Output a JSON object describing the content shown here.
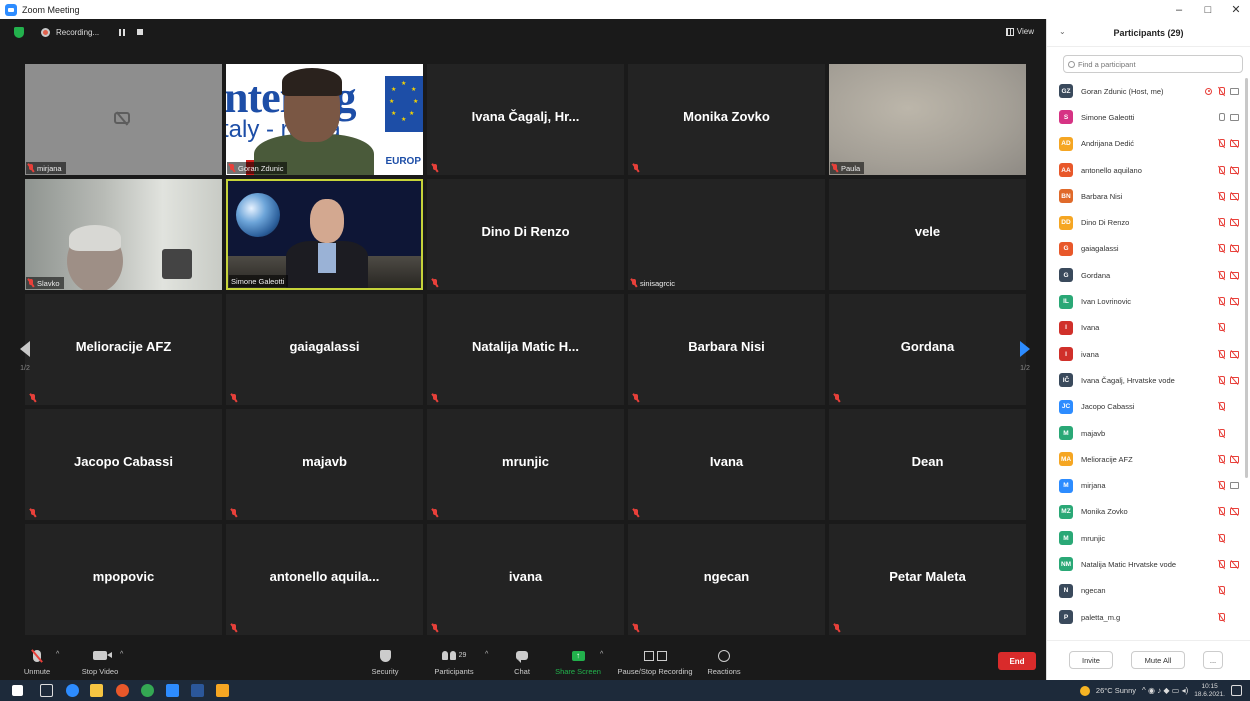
{
  "window": {
    "title": "Zoom Meeting",
    "min": "–",
    "restore": "□",
    "close": "✕"
  },
  "topbar": {
    "recording_label": "Recording...",
    "view_label": "View"
  },
  "tiles": [
    {
      "name": "mirjana"
    },
    {
      "name": "Goran Zdunic"
    },
    {
      "name": "Ivana Čagalj, Hr..."
    },
    {
      "name": "Monika Zovko"
    },
    {
      "name": "Paula"
    },
    {
      "name": "Slavko"
    },
    {
      "name": "Simone Galeotti"
    },
    {
      "name": "Dino Di Renzo"
    },
    {
      "name": "sinisagrcic"
    },
    {
      "name": "vele"
    },
    {
      "name": "Melioracije AFZ"
    },
    {
      "name": "gaiagalassi"
    },
    {
      "name": "Natalija Matic H..."
    },
    {
      "name": "Barbara Nisi"
    },
    {
      "name": "Gordana"
    },
    {
      "name": "Jacopo Cabassi"
    },
    {
      "name": "majavb"
    },
    {
      "name": "mrunjic"
    },
    {
      "name": "Ivana"
    },
    {
      "name": "Dean"
    },
    {
      "name": "mpopovic"
    },
    {
      "name": "antonello aquila..."
    },
    {
      "name": "ivana"
    },
    {
      "name": "ngecan"
    },
    {
      "name": "Petar Maleta"
    }
  ],
  "slide": {
    "brand": "nterreg",
    "line2": "taly - roatia",
    "eu": "EUROP"
  },
  "pager": {
    "left_page": "1/2",
    "right_page": "1/2"
  },
  "toolbar": {
    "unmute": "Unmute",
    "stop_video": "Stop Video",
    "security": "Security",
    "participants": "Participants",
    "participants_count": "29",
    "chat": "Chat",
    "share_screen": "Share Screen",
    "pause_stop_recording": "Pause/Stop Recording",
    "reactions": "Reactions",
    "end": "End"
  },
  "panel": {
    "title": "Participants (29)",
    "search_placeholder": "Find a participant",
    "invite": "Invite",
    "mute_all": "Mute All",
    "more": "...",
    "participants": [
      {
        "initials": "GZ",
        "name": "Goran Zdunic (Host, me)",
        "color": "#3a4a5c",
        "mic": "muted",
        "cam": "on",
        "rec": true
      },
      {
        "initials": "S",
        "name": "Simone Galeotti",
        "color": "#d63384",
        "mic": "on",
        "cam": "on",
        "rec": false
      },
      {
        "initials": "AD",
        "name": "Andrijana Dedić",
        "color": "#f5a623",
        "mic": "muted",
        "cam": "off",
        "rec": false
      },
      {
        "initials": "AA",
        "name": "antonello aquilano",
        "color": "#e8582a",
        "mic": "muted",
        "cam": "off",
        "rec": false
      },
      {
        "initials": "BN",
        "name": "Barbara Nisi",
        "color": "#e06a2a",
        "mic": "muted",
        "cam": "off",
        "rec": false
      },
      {
        "initials": "DD",
        "name": "Dino Di Renzo",
        "color": "#f5a623",
        "mic": "muted",
        "cam": "off",
        "rec": false
      },
      {
        "initials": "G",
        "name": "gaiagalassi",
        "color": "#e8582a",
        "mic": "muted",
        "cam": "off",
        "rec": false
      },
      {
        "initials": "G",
        "name": "Gordana",
        "color": "#3a4a5c",
        "mic": "muted",
        "cam": "off",
        "rec": false
      },
      {
        "initials": "IL",
        "name": "Ivan Lovrinovic",
        "color": "#2aa876",
        "mic": "muted",
        "cam": "off",
        "rec": false
      },
      {
        "initials": "I",
        "name": "Ivana",
        "color": "#d0302a",
        "mic": "muted",
        "cam": "none",
        "rec": false
      },
      {
        "initials": "I",
        "name": "ivana",
        "color": "#d0302a",
        "mic": "muted",
        "cam": "off",
        "rec": false
      },
      {
        "initials": "IČ",
        "name": "Ivana Čagalj, Hrvatske vode",
        "color": "#3a4a5c",
        "mic": "muted",
        "cam": "off",
        "rec": false
      },
      {
        "initials": "JC",
        "name": "Jacopo Cabassi",
        "color": "#2d8cff",
        "mic": "muted",
        "cam": "none",
        "rec": false
      },
      {
        "initials": "M",
        "name": "majavb",
        "color": "#2aa876",
        "mic": "muted",
        "cam": "none",
        "rec": false
      },
      {
        "initials": "MA",
        "name": "Melioracije AFZ",
        "color": "#f5a623",
        "mic": "muted",
        "cam": "off",
        "rec": false
      },
      {
        "initials": "M",
        "name": "mirjana",
        "color": "#2d8cff",
        "mic": "muted",
        "cam": "on",
        "rec": false
      },
      {
        "initials": "MZ",
        "name": "Monika Zovko",
        "color": "#2aa876",
        "mic": "muted",
        "cam": "off",
        "rec": false
      },
      {
        "initials": "M",
        "name": "mrunjic",
        "color": "#2aa876",
        "mic": "muted",
        "cam": "none",
        "rec": false
      },
      {
        "initials": "NM",
        "name": "Natalija Matic Hrvatske vode",
        "color": "#2aa876",
        "mic": "muted",
        "cam": "off",
        "rec": false
      },
      {
        "initials": "N",
        "name": "ngecan",
        "color": "#3a4a5c",
        "mic": "muted",
        "cam": "none",
        "rec": false
      },
      {
        "initials": "P",
        "name": "paletta_m.g",
        "color": "#3a4a5c",
        "mic": "muted",
        "cam": "none",
        "rec": false
      }
    ]
  },
  "taskbar": {
    "weather": "26°C  Sunny",
    "time": "10:15",
    "date": "18.6.2021."
  }
}
